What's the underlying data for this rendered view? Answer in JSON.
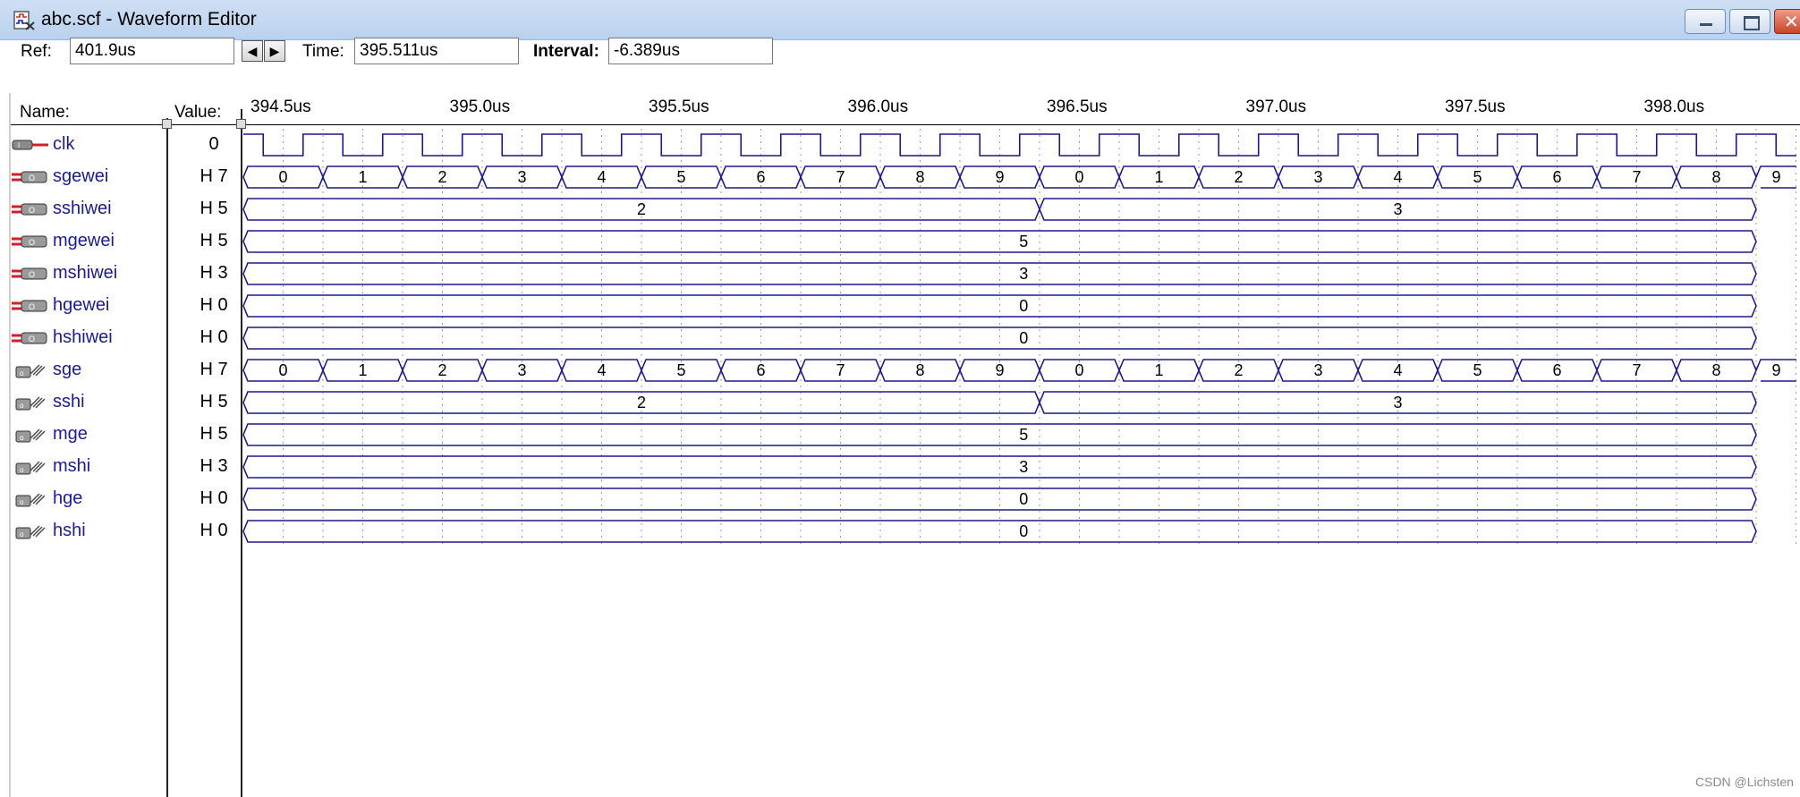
{
  "window": {
    "title": "abc.scf - Waveform Editor"
  },
  "toolbar": {
    "ref_label": "Ref:",
    "ref_value": "401.9us",
    "time_label": "Time:",
    "time_value": "395.511us",
    "interval_label": "Interval:",
    "interval_value": "-6.389us",
    "prev_arrow": "◀",
    "next_arrow": "▶"
  },
  "columns": {
    "name_header": "Name:",
    "value_header": "Value:"
  },
  "timeline": {
    "ticks": [
      "394.5us",
      "395.0us",
      "395.5us",
      "396.0us",
      "396.5us",
      "397.0us",
      "397.5us",
      "398.0us"
    ],
    "start_us": 394.5,
    "end_us": 398.3,
    "clk_period_us": 0.2,
    "count_step_us": 0.2,
    "bus_color": "#1c1c8c",
    "clk_color": "#1a1a80"
  },
  "signals": [
    {
      "name": "clk",
      "value": "0",
      "kind": "clk",
      "icon": "input-pin-icon"
    },
    {
      "name": "sgewei",
      "value": "H 7",
      "kind": "counter10",
      "icon": "output-bus-icon"
    },
    {
      "name": "sshiwei",
      "value": "H 5",
      "kind": "tens",
      "first": "2",
      "second": "3",
      "icon": "output-bus-icon"
    },
    {
      "name": "mgewei",
      "value": "H 5",
      "kind": "const",
      "text": "5",
      "icon": "output-bus-icon"
    },
    {
      "name": "mshiwei",
      "value": "H 3",
      "kind": "const",
      "text": "3",
      "icon": "output-bus-icon"
    },
    {
      "name": "hgewei",
      "value": "H 0",
      "kind": "const",
      "text": "0",
      "icon": "output-bus-icon"
    },
    {
      "name": "hshiwei",
      "value": "H 0",
      "kind": "const",
      "text": "0",
      "icon": "output-bus-icon"
    },
    {
      "name": "sge",
      "value": "H 7",
      "kind": "counter10",
      "icon": "buried-bus-icon"
    },
    {
      "name": "sshi",
      "value": "H 5",
      "kind": "tens",
      "first": "2",
      "second": "3",
      "icon": "buried-bus-icon"
    },
    {
      "name": "mge",
      "value": "H 5",
      "kind": "const",
      "text": "5",
      "icon": "buried-bus-icon"
    },
    {
      "name": "mshi",
      "value": "H 3",
      "kind": "const",
      "text": "3",
      "icon": "buried-bus-icon"
    },
    {
      "name": "hge",
      "value": "H 0",
      "kind": "const",
      "text": "0",
      "icon": "buried-bus-icon"
    },
    {
      "name": "hshi",
      "value": "H 0",
      "kind": "const",
      "text": "0",
      "icon": "buried-bus-icon"
    }
  ],
  "watermark": "CSDN @Lichsten"
}
